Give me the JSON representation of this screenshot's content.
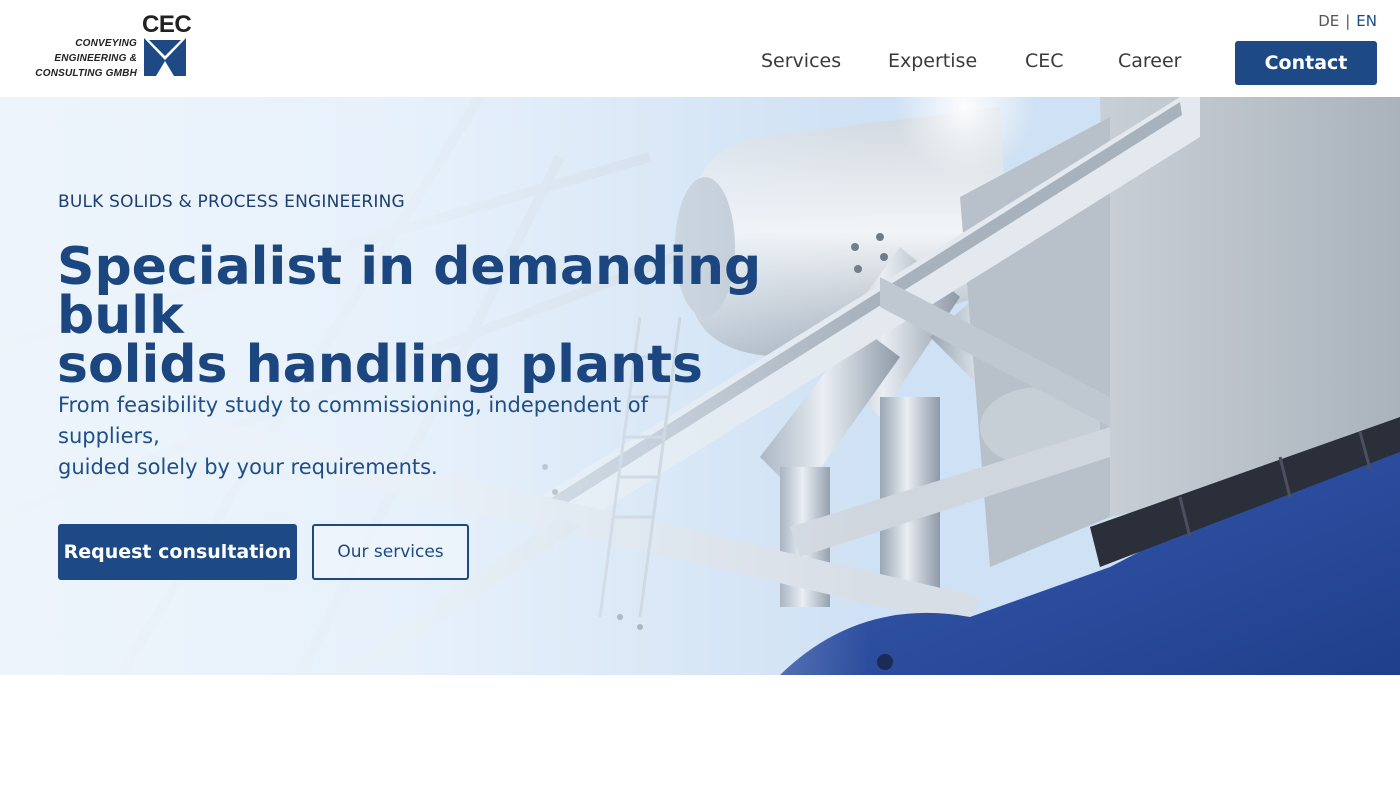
{
  "brand": {
    "logo_text": "CEC",
    "logo_lines": [
      "CONVEYING",
      "ENGINEERING &",
      "CONSULTING GMBH"
    ],
    "color": "#1d4a85"
  },
  "language": {
    "options": [
      "DE",
      "EN"
    ],
    "separator": "|",
    "active": "EN"
  },
  "nav": {
    "items": [
      "Services",
      "Expertise",
      "CEC",
      "Career"
    ],
    "contact_label": "Contact"
  },
  "hero": {
    "eyebrow": "BULK SOLIDS & PROCESS ENGINEERING",
    "headline_line1": "Specialist in demanding bulk",
    "headline_line2": "solids handling plants",
    "lead_line1": "From feasibility study to commissioning, independent of suppliers,",
    "lead_line2": "guided solely by your requirements.",
    "primary_cta": "Request consultation",
    "secondary_cta": "Our services"
  },
  "colors": {
    "accent": "#1d4a85",
    "headline": "#1b467f",
    "machine_blue": "#2e4f9e"
  }
}
